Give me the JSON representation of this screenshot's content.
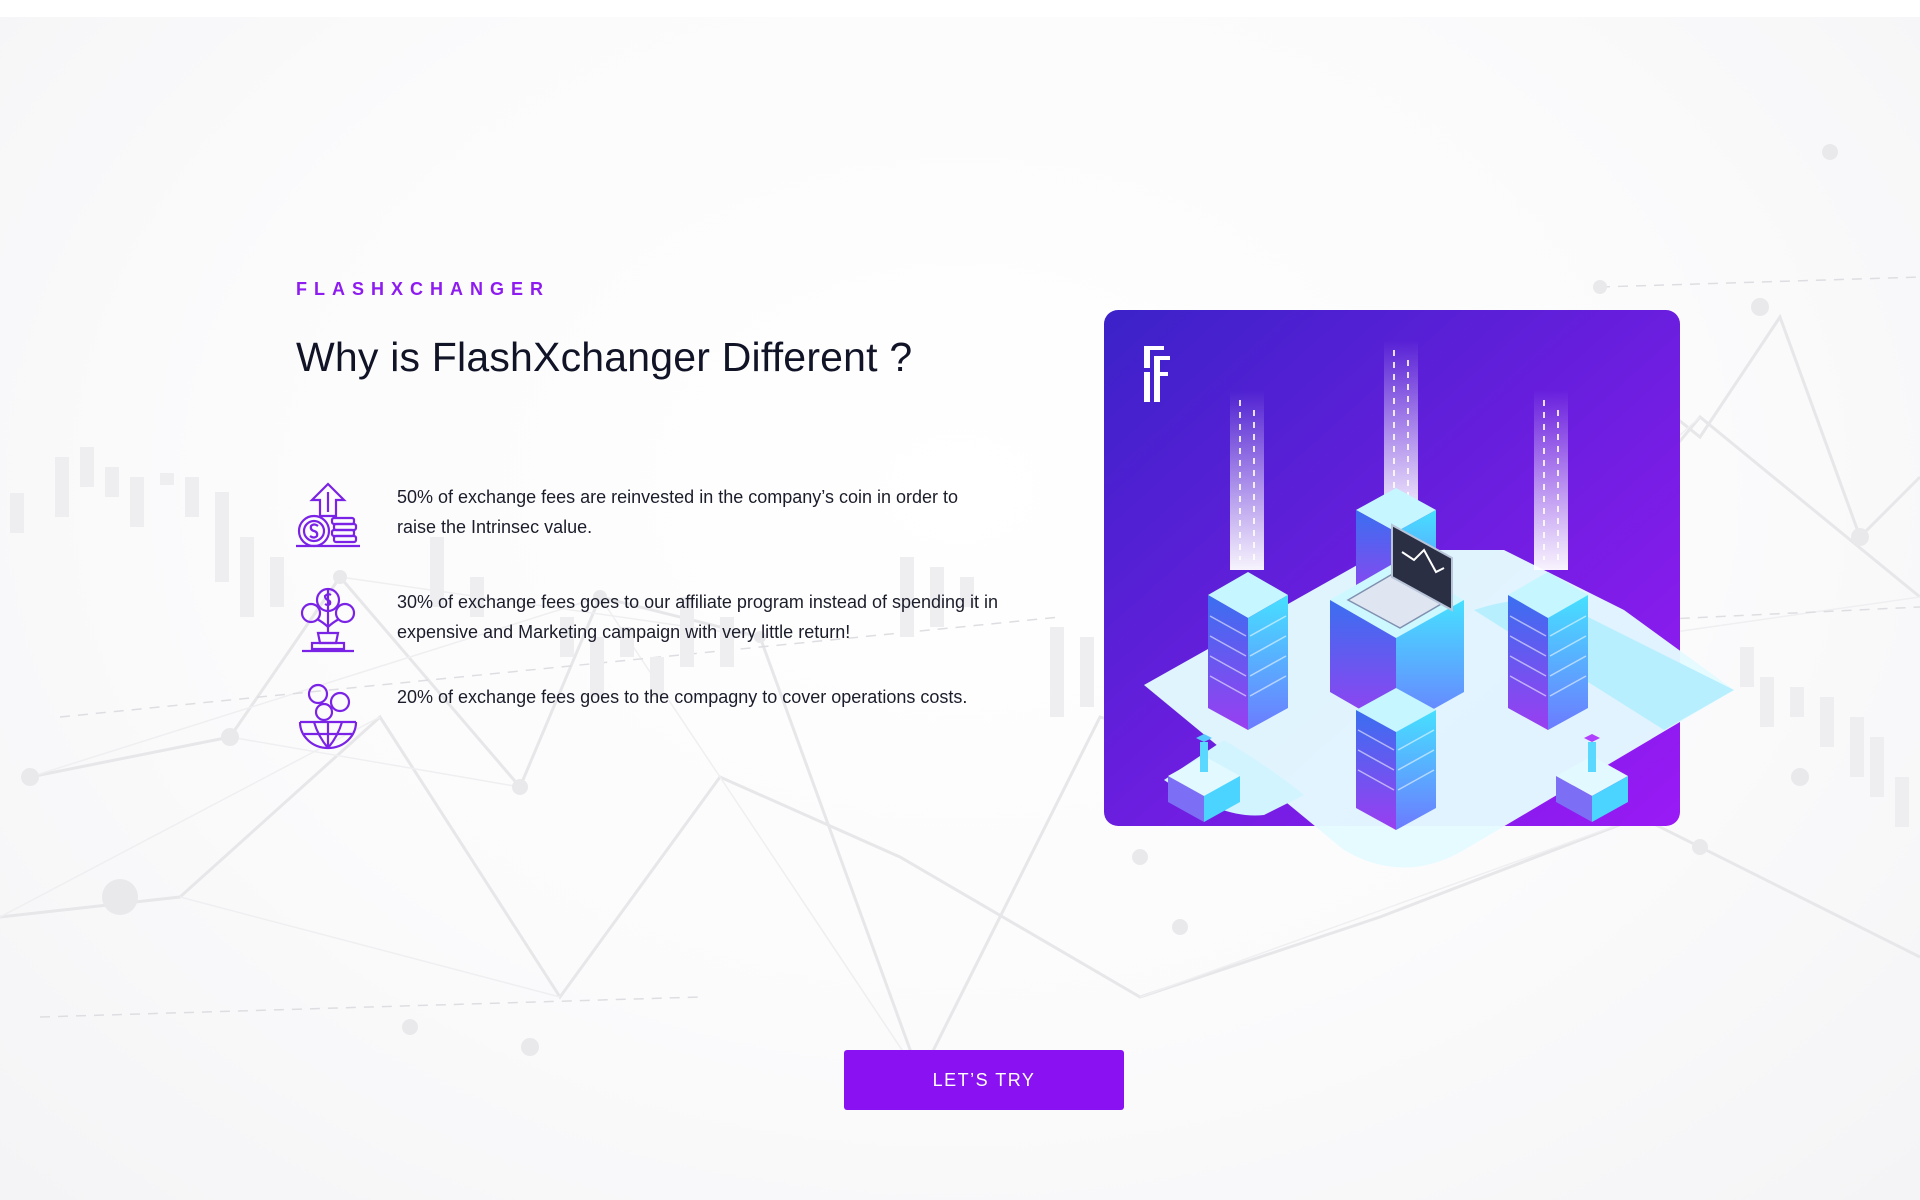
{
  "section": {
    "eyebrow": "FLASHXCHANGER",
    "title": "Why is FlashXchanger Different ?"
  },
  "features": [
    {
      "icon": "money-growth-icon",
      "text": "50% of exchange fees are reinvested in the company’s coin in order to raise the Intrinsec value."
    },
    {
      "icon": "money-plant-icon",
      "text": "30% of exchange fees goes to our affiliate program instead of spending it in expensive and Marketing campaign with very little return!"
    },
    {
      "icon": "global-money-icon",
      "text": "20% of exchange fees goes to the compagny to cover operations costs."
    }
  ],
  "hero": {
    "logo_icon": "flashxchanger-logo-icon",
    "illustration": "isometric-server-illustration"
  },
  "cta": {
    "label": "LET’S TRY"
  },
  "colors": {
    "accent": "#8a12f2",
    "eyebrow": "#8e1cf1",
    "title": "#111427",
    "card_top": "#3b1fc9",
    "card_bottom": "#9a1af5",
    "server_cyan": "#3fd6ff"
  }
}
